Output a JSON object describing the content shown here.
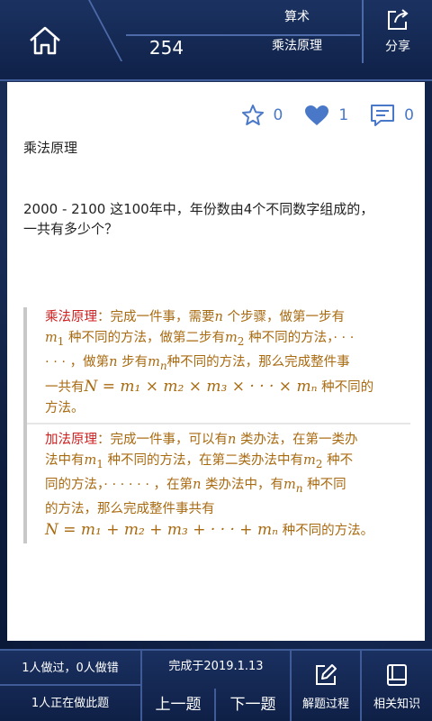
{
  "header": {
    "question_number": "254",
    "category": "算术",
    "subcategory": "乘法原理",
    "share_label": "分享",
    "home_icon": "home-icon",
    "share_icon": "share-icon"
  },
  "stats": {
    "favorite_count": "0",
    "like_count": "1",
    "comment_count": "0"
  },
  "content": {
    "topic": "乘法原理",
    "question_line1": "2000 - 2100 这100年中，年份数由4个不同数字组成的，",
    "question_line2": "一共有多少个？",
    "mult": {
      "head": "乘法原理",
      "t1": "：完成一件事，需要",
      "n1": "n",
      "t2": " 个步骤，做第一步有",
      "m1": "m",
      "s1": "1",
      "t3": " 种不同的方法，做第二步有",
      "m2": "m",
      "s2": "2",
      "t4": " 种不同的方法，· · · ",
      "t5": "· · · ，做第",
      "n2": "n",
      "t6": " 步有",
      "mn": "m",
      "sn": "n",
      "t7": "种不同的方法，那么完成整件事",
      "t8": "一共有",
      "formula": "N = m₁ × m₂ × m₃ × · · · × mₙ",
      "t9": " 种不同的",
      "t10": "方法。"
    },
    "add": {
      "head": "加法原理",
      "t1": "：完成一件事，可以有",
      "n1": "n",
      "t2": " 类办法，在第一类办",
      "t3": "法中有",
      "m1": "m",
      "s1": "1",
      "t4": " 种不同的方法，在第二类办法中有",
      "m2": "m",
      "s2": "2",
      "t5": " 种不",
      "t6": "同的方法，· · · · · · ，在第",
      "n2": "n",
      "t7": " 类办法中，有",
      "mn": "m",
      "sn": "n",
      "t8": " 种不同",
      "t9": "的方法，那么完成整件事共有",
      "formula": "N = m₁ + m₂ + m₃ + · · · + mₙ",
      "t10": " 种不同的方法。"
    }
  },
  "footer": {
    "done_wrong": "1人做过，0人做错",
    "doing_now": "1人正在做此题",
    "completed": "完成于2019.1.13",
    "prev": "上一题",
    "next": "下一题",
    "solution": "解题过程",
    "knowledge": "相关知识"
  },
  "colors": {
    "accent_blue": "#4a78c8",
    "theory_text": "#a86a10",
    "theory_head": "#cc1f1f",
    "frame": "#0f2148"
  }
}
